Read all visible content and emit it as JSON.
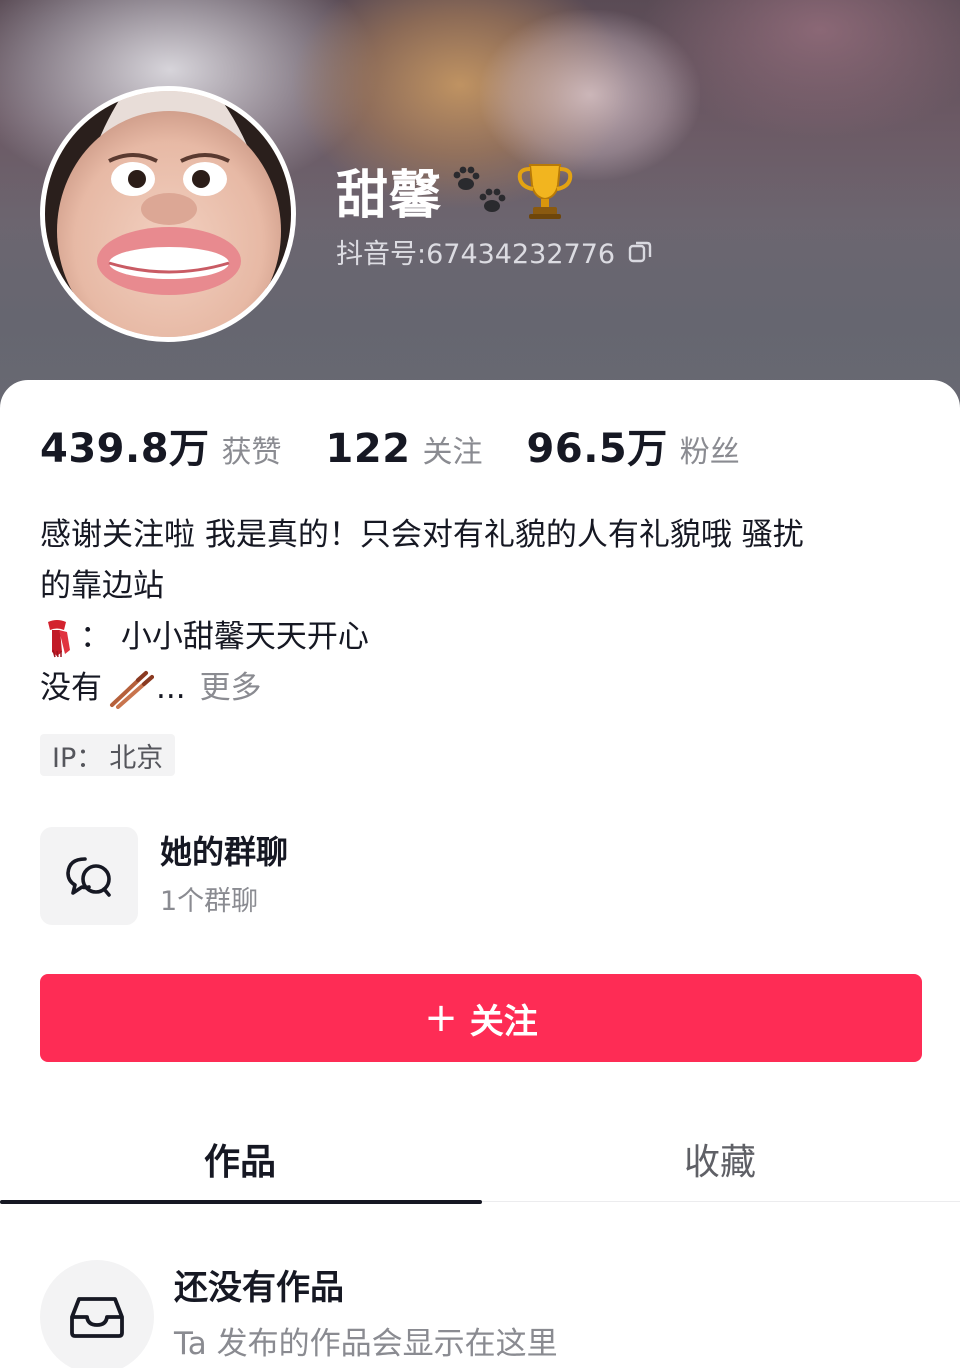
{
  "profile": {
    "nickname": "甜馨",
    "douyin_id": "抖音号:67434232776"
  },
  "stats": [
    {
      "value": "439.8万",
      "label": "获赞"
    },
    {
      "value": "122",
      "label": "关注"
    },
    {
      "value": "96.5万",
      "label": "粉丝"
    }
  ],
  "bio": {
    "line1": "感谢关注啦 我是真的！只会对有礼貌的人有礼貌哦 骚扰",
    "line2": "的靠边站",
    "line3_text": "：  小小甜馨天天开心",
    "line4_prefix": "没有",
    "line4_ellipsis": "...",
    "more": "更多"
  },
  "ip": {
    "label": "IP：",
    "value": "北京"
  },
  "group_chat": {
    "title": "她的群聊",
    "count": "1个群聊"
  },
  "follow_button": {
    "plus": "+",
    "label": "关注"
  },
  "tabs": [
    {
      "label": "作品",
      "active": true
    },
    {
      "label": "收藏",
      "active": false
    }
  ],
  "empty_state": {
    "title": "还没有作品",
    "subtitle": "Ta 发布的作品会显示在这里"
  },
  "icons": {
    "paw": "paw-prints-icon",
    "trophy": "trophy-icon",
    "copy": "copy-icon",
    "scarf": "red-scarf-icon",
    "chopsticks": "chopsticks-icon",
    "group": "chat-bubbles-icon",
    "empty": "inbox-tray-icon"
  },
  "colors": {
    "accent": "#fe2c55",
    "text_primary": "#161823",
    "text_secondary": "#8a8b91"
  }
}
